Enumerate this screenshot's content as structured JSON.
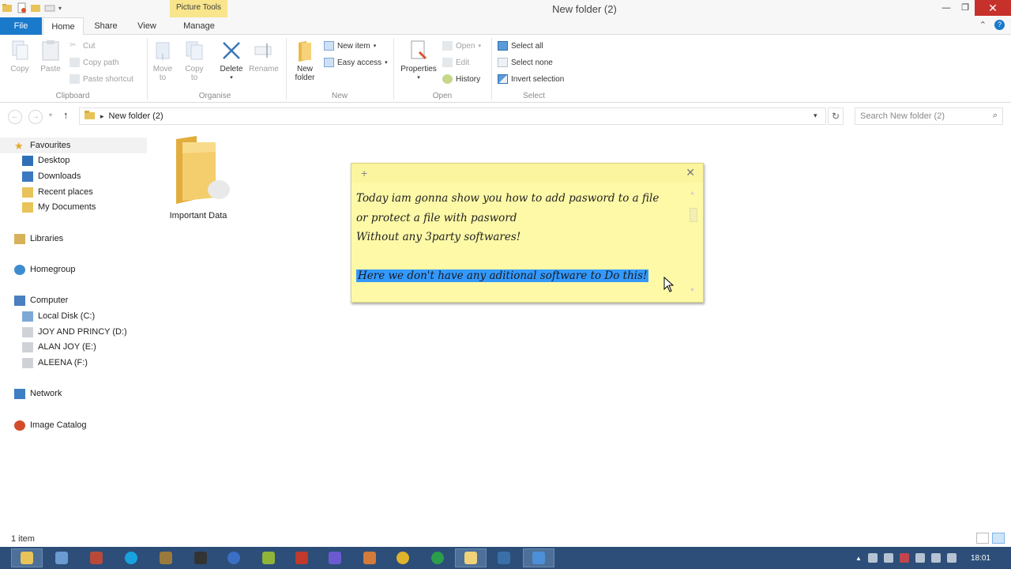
{
  "window": {
    "title": "New folder (2)",
    "context_tab": "Picture Tools"
  },
  "ribbon_tabs": [
    "File",
    "Home",
    "Share",
    "View",
    "Manage"
  ],
  "ribbon": {
    "clipboard": {
      "copy": "Copy",
      "paste": "Paste",
      "cut": "Cut",
      "copy_path": "Copy path",
      "paste_shortcut": "Paste shortcut",
      "group": "Clipboard"
    },
    "organise": {
      "move_to": [
        "Move",
        "to"
      ],
      "copy_to": [
        "Copy",
        "to"
      ],
      "delete": "Delete",
      "rename": "Rename",
      "group": "Organise"
    },
    "new": {
      "new_folder": [
        "New",
        "folder"
      ],
      "new_item": "New item",
      "easy_access": "Easy access",
      "group": "New"
    },
    "open": {
      "properties": "Properties",
      "open": "Open",
      "edit": "Edit",
      "history": "History",
      "group": "Open"
    },
    "select": {
      "select_all": "Select all",
      "select_none": "Select none",
      "invert_selection": "Invert selection",
      "group": "Select"
    }
  },
  "address": {
    "path": "New folder (2)",
    "search_placeholder": "Search New folder (2)"
  },
  "nav": {
    "favourites": "Favourites",
    "fav_items": [
      "Desktop",
      "Downloads",
      "Recent places",
      "My Documents"
    ],
    "libraries": "Libraries",
    "homegroup": "Homegroup",
    "computer": "Computer",
    "drives": [
      "Local Disk (C:)",
      "JOY AND PRINCY (D:)",
      "ALAN JOY (E:)",
      "ALEENA (F:)"
    ],
    "network": "Network",
    "image_catalog": "Image Catalog"
  },
  "content": {
    "folder_name": "Important Data"
  },
  "sticky_note": {
    "lines": [
      "Today iam gonna show you how to add pasword to a file",
      "or protect a file with pasword",
      "Without any 3party softwares!",
      "",
      "Here we don't have any aditional software to Do this!"
    ]
  },
  "status": {
    "item_count": "1 item"
  },
  "taskbar": {
    "time": "18:01"
  },
  "colors": {
    "file_tab": "#1979ca",
    "context_tab": "#f8e58c",
    "close_button": "#c7312b",
    "sticky_bg": "#fdf9a7",
    "selection_highlight": "#3399ff",
    "taskbar": "#2c4e79"
  }
}
